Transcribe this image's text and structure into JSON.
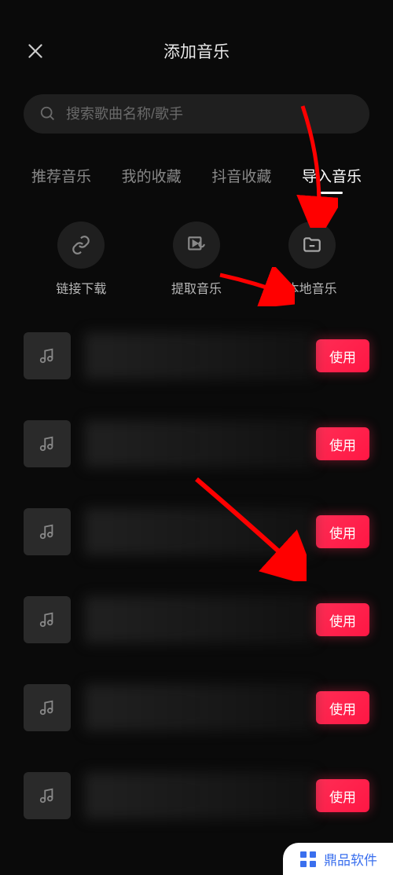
{
  "header": {
    "title": "添加音乐"
  },
  "search": {
    "placeholder": "搜索歌曲名称/歌手"
  },
  "tabs": [
    {
      "label": "推荐音乐",
      "active": false
    },
    {
      "label": "我的收藏",
      "active": false
    },
    {
      "label": "抖音收藏",
      "active": false
    },
    {
      "label": "导入音乐",
      "active": true
    }
  ],
  "import_options": [
    {
      "label": "链接下载",
      "icon": "link"
    },
    {
      "label": "提取音乐",
      "icon": "extract"
    },
    {
      "label": "本地音乐",
      "icon": "folder"
    }
  ],
  "music_items": [
    {
      "use_label": "使用"
    },
    {
      "use_label": "使用"
    },
    {
      "use_label": "使用"
    },
    {
      "use_label": "使用"
    },
    {
      "use_label": "使用"
    },
    {
      "use_label": "使用"
    }
  ],
  "watermark": {
    "text": "鼎品软件"
  }
}
